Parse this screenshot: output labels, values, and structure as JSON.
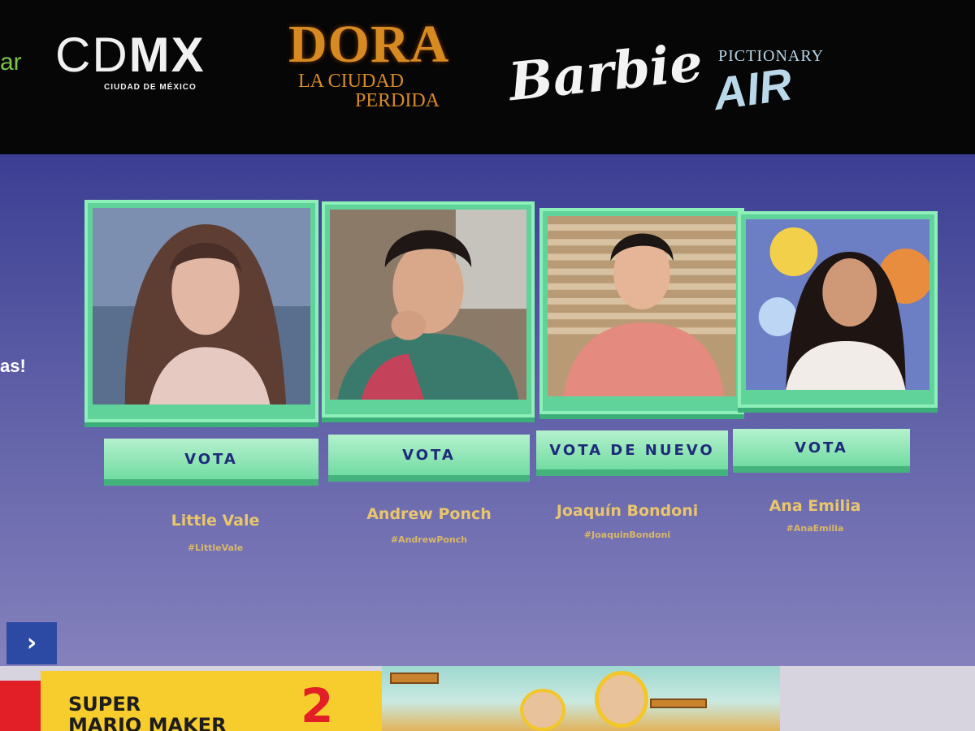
{
  "sponsors": {
    "partial_text": "ar",
    "cdmx": {
      "bold": "MX",
      "light": "CD",
      "sub": "CIUDAD DE MÉXICO"
    },
    "dora": {
      "title": "DORA",
      "sub1": "LA CIUDAD",
      "sub2": "PERDIDA"
    },
    "barbie": "Barbie",
    "pictionary": {
      "top": "PICTIONARY",
      "bottom": "AIR"
    }
  },
  "side_text": "as!",
  "candidates": [
    {
      "name": "Little Vale",
      "hashtag": "#LittleVale",
      "button": "VOTA"
    },
    {
      "name": "Andrew Ponch",
      "hashtag": "#AndrewPonch",
      "button": "VOTA"
    },
    {
      "name": "Joaquín Bondoni",
      "hashtag": "#JoaquinBondoni",
      "button": "VOTA DE NUEVO"
    },
    {
      "name": "Ana Emilia",
      "hashtag": "#AnaEmilia",
      "button": "VOTA"
    }
  ],
  "next_button": "›",
  "banner": {
    "line1": "SUPER",
    "line2": "MARIO MAKER",
    "number": "2"
  }
}
